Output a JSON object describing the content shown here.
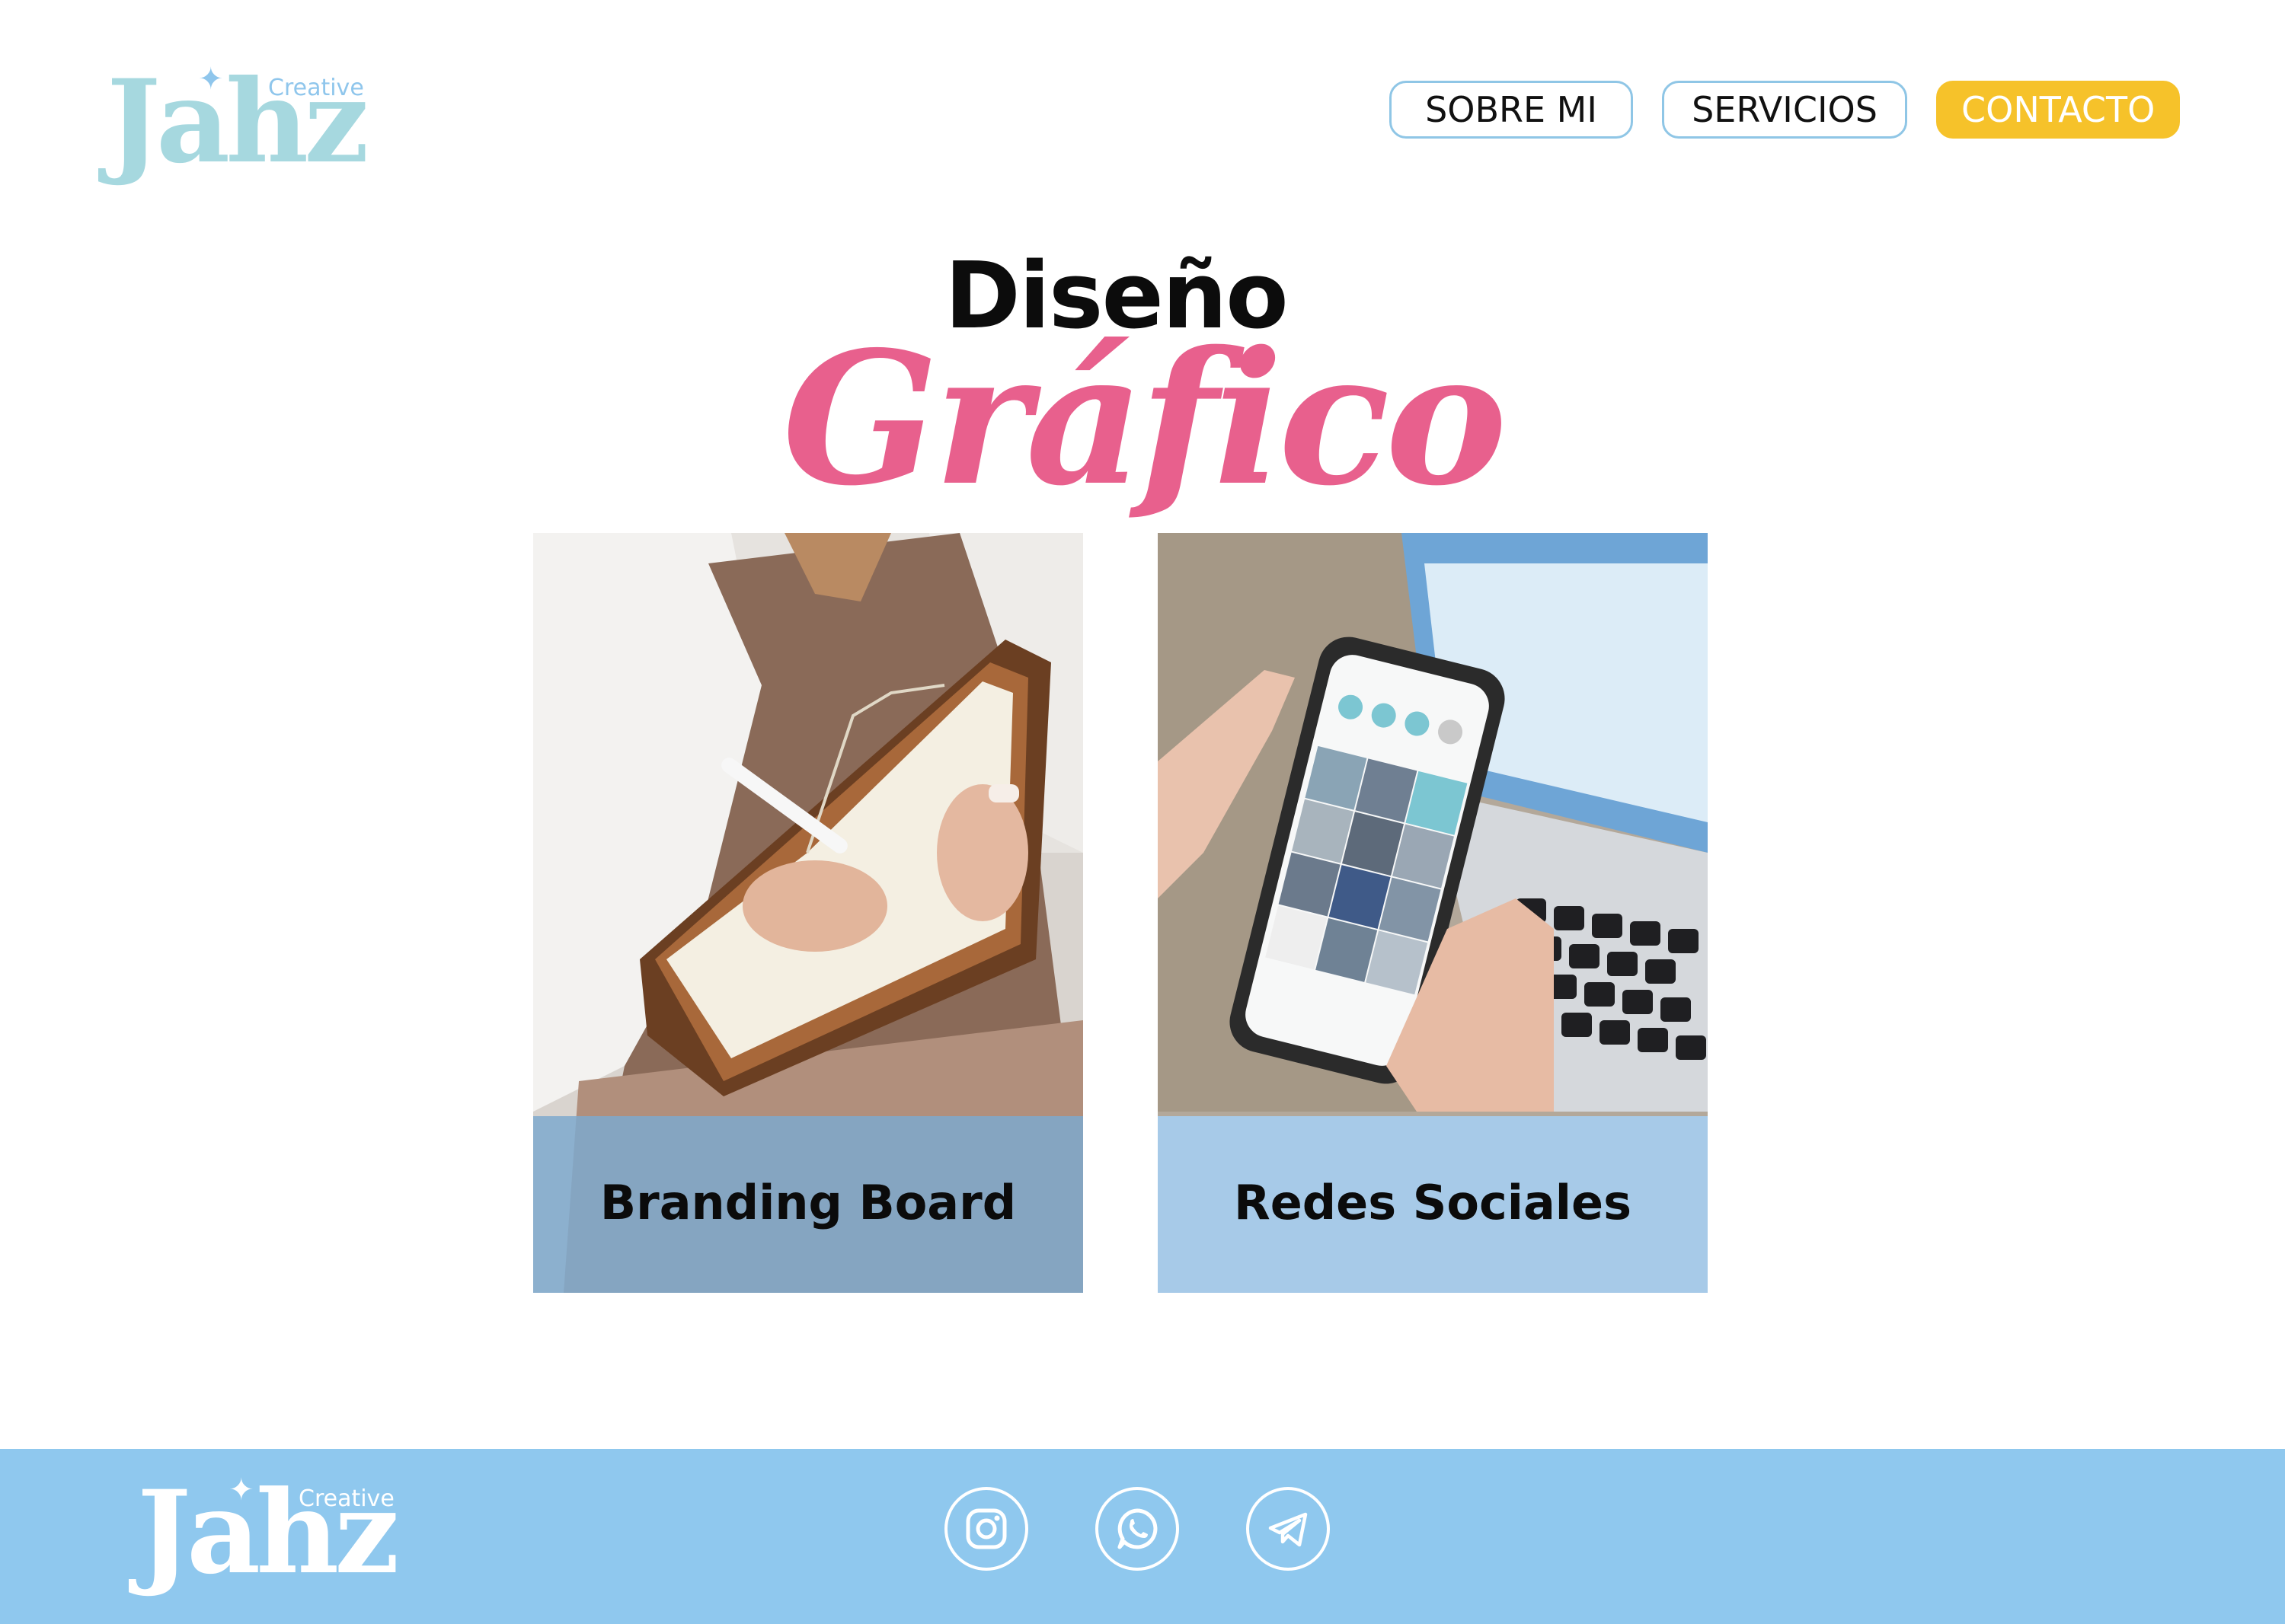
{
  "header": {
    "logo_text": "Jahz",
    "logo_subtext": "Creative",
    "nav": {
      "sobre_mi": "SOBRE MI",
      "servicios": "SERVICIOS",
      "contacto": "CONTACTO"
    }
  },
  "hero": {
    "title_line1": "Diseño",
    "title_line2": "Gráfico"
  },
  "cards": [
    {
      "label": "Branding Board",
      "image_icon": "notebook-writing-photo"
    },
    {
      "label": "Redes Sociales",
      "image_icon": "phone-instagram-photo"
    }
  ],
  "footer": {
    "logo_text": "Jahz",
    "logo_subtext": "Creative",
    "social_icons": [
      "instagram-icon",
      "whatsapp-icon",
      "telegram-icon"
    ]
  },
  "colors": {
    "logo_teal": "#a6d8df",
    "logo_blue": "#8fc6ec",
    "nav_border": "#8fc6e6",
    "contact_yellow": "#f6c22a",
    "title_pink": "#e8608d",
    "caption_band": "#9fc8ea",
    "footer_blue": "#8fc8ee"
  }
}
